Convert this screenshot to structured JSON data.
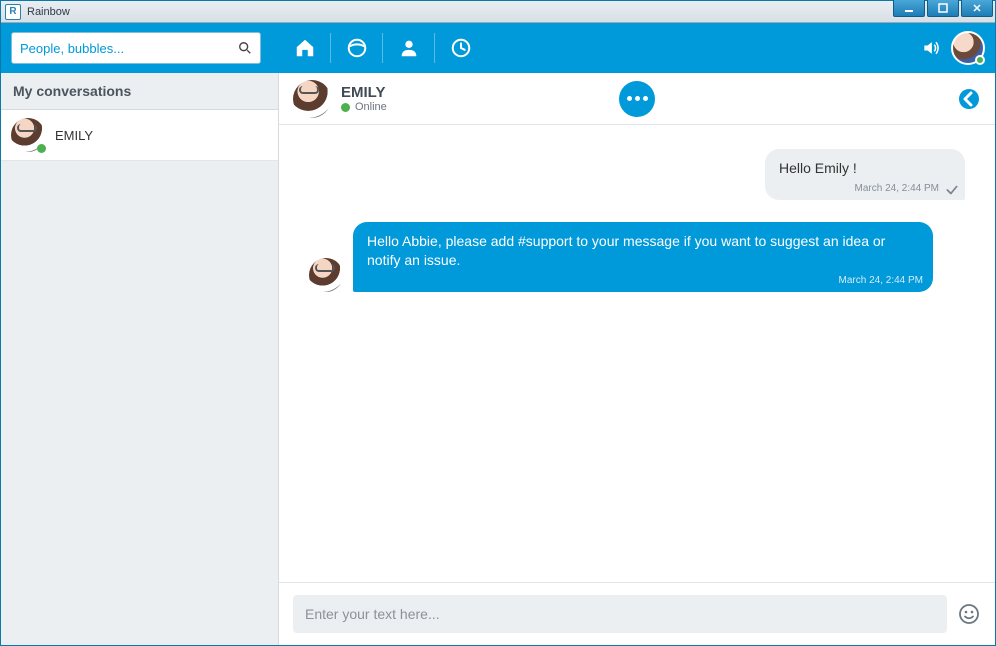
{
  "window": {
    "title": "Rainbow"
  },
  "search": {
    "placeholder": "People, bubbles..."
  },
  "sidebar": {
    "header": "My conversations",
    "items": [
      {
        "name": "EMILY",
        "presence": "online"
      }
    ]
  },
  "chatHeader": {
    "name": "EMILY",
    "statusLabel": "Online"
  },
  "messages": {
    "out1": {
      "text": "Hello Emily !",
      "time": "March 24, 2:44 PM"
    },
    "in1": {
      "text": "Hello Abbie, please add #support to your message if you want to suggest an idea or notify an issue.",
      "time": "March 24, 2:44 PM"
    }
  },
  "composer": {
    "placeholder": "Enter your text here..."
  },
  "icons": {
    "home": "home-icon",
    "globe": "globe-icon",
    "contacts": "contacts-icon",
    "recent": "recent-icon",
    "sound": "sound-icon",
    "search": "search-icon",
    "more": "more-icon",
    "back": "back-icon",
    "emoji": "emoji-icon",
    "minimize": "minimize-icon",
    "maximize": "maximize-icon",
    "close": "close-icon"
  }
}
